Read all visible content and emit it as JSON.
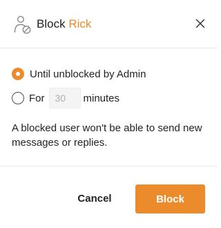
{
  "dialog": {
    "title_prefix": "Block",
    "title_name": "Rick",
    "icon": "user-block-icon",
    "close_icon": "close-icon"
  },
  "options": {
    "until_unblocked_label": "Until unblocked by Admin",
    "until_unblocked_selected": true,
    "for_label": "For",
    "minutes_placeholder": "30",
    "minutes_value": "",
    "minutes_label": "minutes",
    "for_selected": false
  },
  "note": "A blocked user won't be able to send new messages or replies.",
  "actions": {
    "cancel_label": "Cancel",
    "block_label": "Block"
  },
  "colors": {
    "accent": "#ec8b2c",
    "text": "#222222",
    "icon_gray": "#8a8a8a"
  }
}
